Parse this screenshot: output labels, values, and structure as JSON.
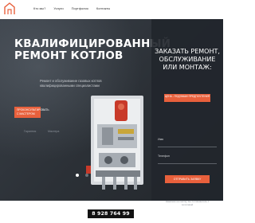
{
  "header": {
    "nav": [
      "Кто мы?",
      "Услуги",
      "Портфолио",
      "Контакты"
    ]
  },
  "hero": {
    "title": "КВАЛИФИЦИРОВАННЫЙ РЕМОНТ КОТЛОВ",
    "subtitle": "Ремонт и обслуживание газовых котлов квалифицированными специалистами",
    "cta_label": "ПРОКОНСУЛЬТИРОВАТЬ С МАСТЕРОМ",
    "features": [
      "Гарантия",
      "Мастера"
    ],
    "slider_active": 1,
    "slider_count": 2
  },
  "form": {
    "title": "ЗАКАЗАТЬ РЕМОНТ, ОБСЛУЖИВАНИЕ ИЛИ МОНТАЖ:",
    "badge": "ЦЕНА - ПОД ВАШИ ПРЕДПОЧТЕНИЯ",
    "name_placeholder": "Имя",
    "phone_placeholder": "Телефон",
    "submit_label": "ОТПРАВИТЬ ЗАЯВКУ",
    "consent": "Нажимая на кнопку, вы соглашаетесь с политикой"
  },
  "phone": "8 928 764 99 37",
  "colors": {
    "accent": "#e8603c",
    "hero_bg": "#2b3036",
    "panel_bg": "#22262c"
  },
  "icons": {
    "logo": "house-icon"
  }
}
